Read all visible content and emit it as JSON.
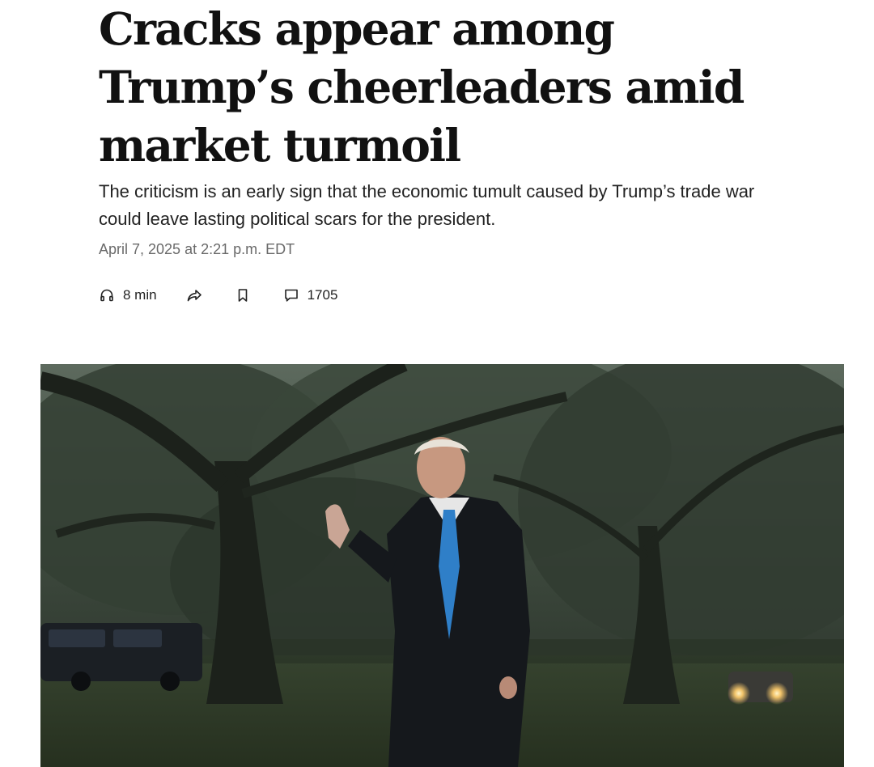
{
  "article": {
    "headline": "Cracks appear among Trump’s cheerleaders amid market turmoil",
    "dek": "The criticism is an early sign that the economic tumult caused by Trump’s trade war could leave lasting political scars for the president.",
    "timestamp": "April 7, 2025 at 2:21 p.m. EDT"
  },
  "actions": {
    "listen_label": "8 min",
    "comments_count": "1705",
    "icons": [
      "headphones-icon",
      "share-icon",
      "bookmark-icon",
      "comment-icon"
    ]
  },
  "colors": {
    "text": "#111111",
    "meta": "#6a6a6a",
    "tie": "#2f7fc8"
  }
}
